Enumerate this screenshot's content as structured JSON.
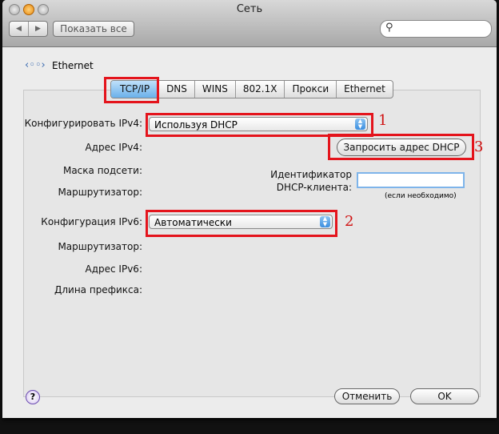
{
  "window": {
    "title": "Сеть"
  },
  "toolbar": {
    "back": "◀",
    "forward": "▶",
    "show_all": "Показать все",
    "search_placeholder": ""
  },
  "service": {
    "name": "Ethernet"
  },
  "tabs": [
    {
      "label": "TCP/IP",
      "selected": true
    },
    {
      "label": "DNS"
    },
    {
      "label": "WINS"
    },
    {
      "label": "802.1X"
    },
    {
      "label": "Прокси"
    },
    {
      "label": "Ethernet"
    }
  ],
  "ipv4": {
    "config_label": "Конфигурировать IPv4:",
    "config_value": "Используя DHCP",
    "address_label": "Адрес IPv4:",
    "mask_label": "Маска подсети:",
    "router_label": "Маршрутизатор:",
    "renew_button": "Запросить адрес DHCP",
    "client_id_label_1": "Идентификатор",
    "client_id_label_2": "DHCP-клиента:",
    "client_id_value": "",
    "client_id_hint": "(если необходимо)"
  },
  "ipv6": {
    "config_label": "Конфигурация IPv6:",
    "config_value": "Автоматически",
    "router_label": "Маршрутизатор:",
    "address_label": "Адрес IPv6:",
    "prefix_label": "Длина префикса:"
  },
  "annotations": [
    "1",
    "2",
    "3"
  ],
  "footer": {
    "help": "?",
    "cancel": "Отменить",
    "ok": "OK"
  },
  "colors": {
    "annotation_red": "#e4141c",
    "selected_tab": "#6ab0ea"
  }
}
